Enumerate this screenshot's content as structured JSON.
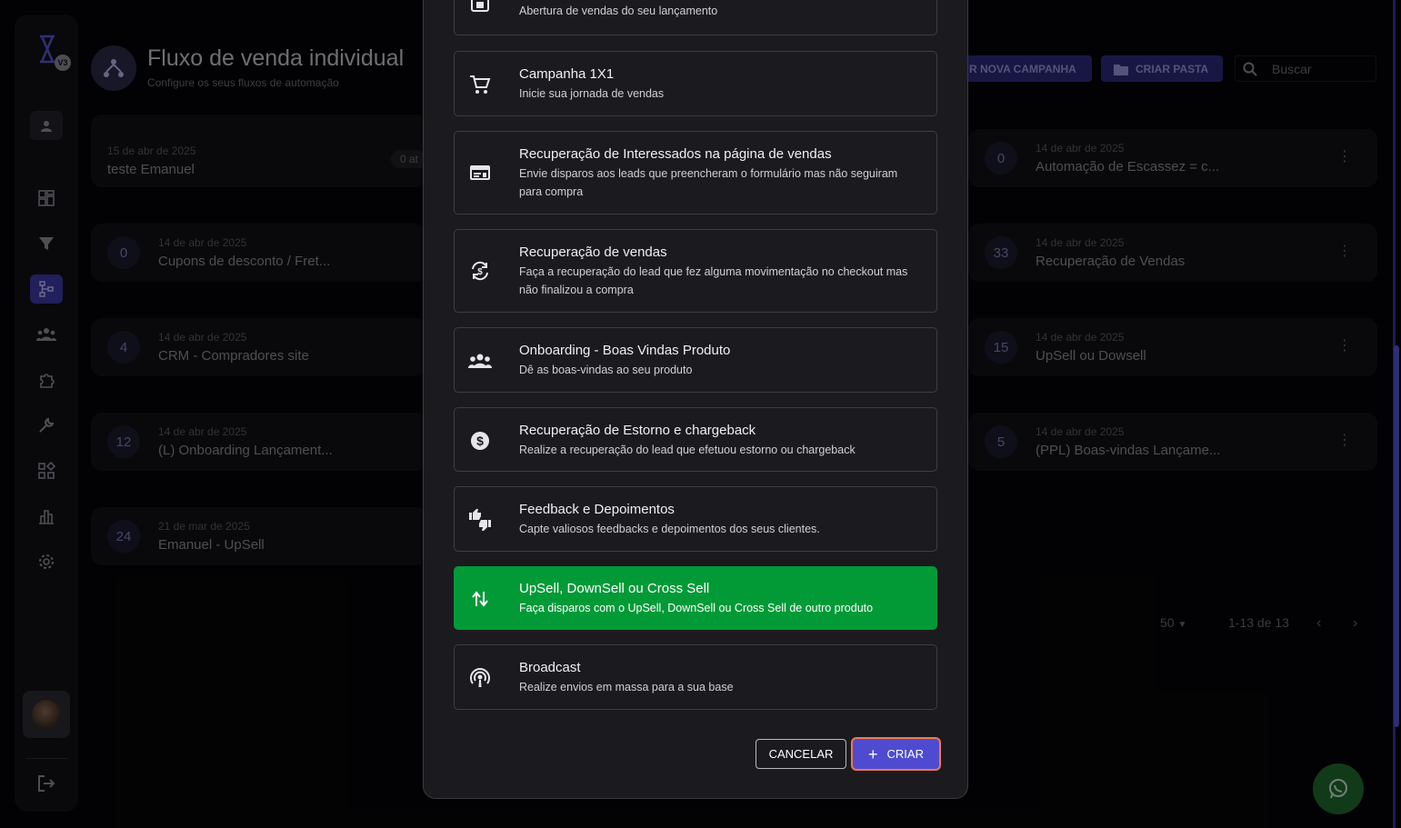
{
  "app": {
    "title": "Fluxo de venda individual",
    "subtitle": "Configure os seus fluxos de automação",
    "logo_badge": "V3"
  },
  "header": {
    "new_campaign_label": "R NOVA CAMPANHA",
    "create_folder_label": "CRIAR PASTA",
    "search_placeholder": "Buscar"
  },
  "sidebar": {
    "icons": [
      "user-icon",
      "dashboard-icon",
      "filter-icon",
      "flow-icon",
      "group-icon",
      "puzzle-icon",
      "wrench-icon",
      "apps-icon",
      "bar-chart-icon",
      "settings-icon",
      "logout-icon"
    ]
  },
  "cards_left": [
    {
      "date": "15 de abr de 2025",
      "name": "teste Emanuel",
      "badge": "0 at"
    },
    {
      "count": "0",
      "date": "14 de abr de 2025",
      "name": "Cupons de desconto / Fret..."
    },
    {
      "count": "4",
      "date": "14 de abr de 2025",
      "name": "CRM - Compradores site"
    },
    {
      "count": "12",
      "date": "14 de abr de 2025",
      "name": "(L) Onboarding Lançament..."
    },
    {
      "count": "24",
      "date": "21 de mar de 2025",
      "name": "Emanuel - UpSell"
    }
  ],
  "cards_right": [
    {
      "count": "0",
      "date": "14 de abr de 2025",
      "name": "Automação de Escassez = c..."
    },
    {
      "count": "33",
      "date": "14 de abr de 2025",
      "name": "Recuperação de Vendas"
    },
    {
      "count": "15",
      "date": "14 de abr de 2025",
      "name": "UpSell ou Dowsell"
    },
    {
      "count": "5",
      "date": "14 de abr de 2025",
      "name": "(PPL) Boas-vindas Lançame..."
    }
  ],
  "pagination": {
    "per_page": "50",
    "range": "1-13 de 13"
  },
  "modal": {
    "options": [
      {
        "title": "",
        "desc": "Abertura de vendas do seu lançamento",
        "icon": "calendar-icon"
      },
      {
        "title": "Campanha 1X1",
        "desc": "Inicie sua jornada de vendas",
        "icon": "cart-icon"
      },
      {
        "title": "Recuperação de Interessados na página de vendas",
        "desc": "Envie disparos aos leads que preencheram o formulário mas não seguiram para compra",
        "icon": "web-form-icon"
      },
      {
        "title": "Recuperação de vendas",
        "desc": "Faça a recuperação do lead que fez alguma movimentação no checkout mas não finalizou a compra",
        "icon": "currency-sync-icon"
      },
      {
        "title": "Onboarding - Boas Vindas Produto",
        "desc": "Dê as boas-vindas ao seu produto",
        "icon": "people-icon"
      },
      {
        "title": "Recuperação de Estorno e chargeback",
        "desc": "Realize a recuperação do lead que efetuou estorno ou chargeback",
        "icon": "dollar-circle-icon"
      },
      {
        "title": "Feedback e Depoimentos",
        "desc": "Capte valiosos feedbacks e depoimentos dos seus clientes.",
        "icon": "thumbs-icon"
      },
      {
        "title": "UpSell, DownSell ou Cross Sell",
        "desc": "Faça disparos com o UpSell, DownSell ou Cross Sell de outro produto",
        "icon": "swap-vertical-icon"
      },
      {
        "title": "Broadcast",
        "desc": "Realize envios em massa para a sua base",
        "icon": "podcast-icon"
      }
    ],
    "selected_index": 7,
    "cancel_label": "CANCELAR",
    "create_label": "CRIAR"
  },
  "colors": {
    "selected_option": "#029a37",
    "primary_button": "#4f4bd0",
    "focus_ring": "#f07a4a"
  }
}
